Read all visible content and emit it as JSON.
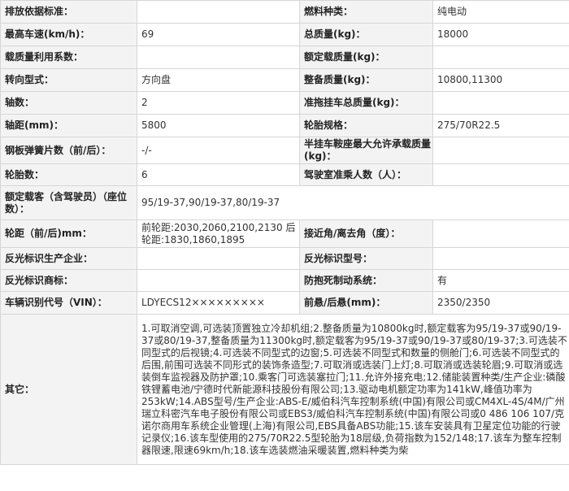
{
  "rows": [
    {
      "l1": "排放依据标准：",
      "v1": "",
      "l2": "燃料种类：",
      "v2": "纯电动"
    },
    {
      "l1": "最高车速(km/h)：",
      "v1": "69",
      "l2": "总质量(kg)：",
      "v2": "18000"
    },
    {
      "l1": "载质量利用系数：",
      "v1": "",
      "l2": "额定载质量(kg)：",
      "v2": ""
    },
    {
      "l1": "转向型式：",
      "v1": "方向盘",
      "l2": "整备质量(kg)：",
      "v2": "10800,11300"
    },
    {
      "l1": "轴数：",
      "v1": "2",
      "l2": "准拖挂车总质量(kg)：",
      "v2": ""
    },
    {
      "l1": "轴距(mm)：",
      "v1": "5800",
      "l2": "轮胎规格：",
      "v2": "275/70R22.5"
    },
    {
      "l1": "钢板弹簧片数（前/后）：",
      "v1": "-/-",
      "l2": "半挂车鞍座最大允许承载质量(kg)：",
      "v2": ""
    },
    {
      "l1": "轮胎数：",
      "v1": "6",
      "l2": "驾驶室准乘人数（人）：",
      "v2": ""
    },
    {
      "l1": "额定载客（含驾驶员）（座位数）：",
      "v1": "95/19-37,90/19-37,80/19-37",
      "l2": "",
      "v2": ""
    },
    {
      "l1": "轮距（前/后)mm：",
      "v1": "前轮距:2030,2060,2100,2130 后轮距:1830,1860,1895",
      "l2": "接近角/离去角（度）：",
      "v2": ""
    },
    {
      "l1": "反光标识生产企业：",
      "v1": "",
      "l2": "反光标识型号：",
      "v2": ""
    },
    {
      "l1": "反光标识商标：",
      "v1": "",
      "l2": "防抱死制动系统：",
      "v2": "有"
    },
    {
      "l1": "车辆识别代号（VIN）：",
      "v1": "LDYECS12×××××××××",
      "l2": "前悬/后悬(mm)：",
      "v2": "2350/2350"
    }
  ],
  "other": {
    "label": "其它：",
    "value": "1.可取消空调,可选装顶置独立冷却机组;2.整备质量为10800kg时,额定载客为95/19-37或90/19-37或80/19-37,整备质量为11300kg时,额定载客为95/19-37或90/19-37或80/19-37;3.可选装不同型式的后视镜;4.可选装不同型式的边窗;5.可选装不同型式和数量的侧舱门;6.可选装不同型式的后围,前围可选装不同形式的装饰条造型;7.可取消或选装门上灯;8.可取消或选装轮眉;9.可取消或选装倒车监视器及防护罩;10.乘客门可选装塞拉门;11.允许外接充电;12.储能装置种类/生产企业:磷酸铁锂蓄电池/宁德时代新能源科技股份有限公司;13.驱动电机额定功率为141kW,峰值功率为253kW;14.ABS型号/生产企业:ABS-E/威伯科汽车控制系统(中国)有限公司或CM4XL-4S/4M/广州瑞立科密汽车电子股份有限公司或EBS3/威伯科汽车控制系统(中国)有限公司或0 486 106 107/克诺尔商用车系统企业管理(上海)有限公司,EBS具备ABS功能;15.该车安装具有卫星定位功能的行驶记录仪;16.该车型使用的275/70R22.5型轮胎为18层级,负荷指数为152/148;17.该车为整车控制器限速,限速69km/h;18.该车选装燃油采暖装置,燃料种类为柴"
  }
}
